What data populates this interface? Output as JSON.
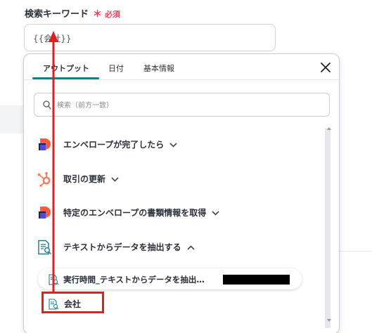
{
  "field": {
    "label": "検索キーワード",
    "required_star": "＊",
    "required_text": "必須",
    "value": "{{会社}}"
  },
  "panel": {
    "tabs": [
      {
        "label": "アウトプット",
        "active": true
      },
      {
        "label": "日付",
        "active": false
      },
      {
        "label": "基本情報",
        "active": false
      }
    ],
    "close_icon": "close-icon",
    "search": {
      "placeholder": "検索（前方一致）",
      "value": ""
    },
    "groups": [
      {
        "label": "エンベロープが完了したら",
        "icon": "docusign-icon",
        "expanded": false
      },
      {
        "label": "取引の更新",
        "icon": "hubspot-icon",
        "expanded": false
      },
      {
        "label": "特定のエンベロープの書類情報を取得",
        "icon": "docusign-icon",
        "expanded": false
      },
      {
        "label": "テキストからデータを抽出する",
        "icon": "document-search-icon",
        "expanded": true
      }
    ],
    "chip": {
      "label": "実行時間_テキストからデータを抽出…",
      "icon": "document-search-icon"
    },
    "item": {
      "label": "会社",
      "icon": "document-search-icon"
    }
  },
  "colors": {
    "accent": "#1a7a8c",
    "required": "#e8425a",
    "highlight": "#e02020",
    "docusign": "#ff5a3c",
    "hubspot": "#ff7a59"
  }
}
